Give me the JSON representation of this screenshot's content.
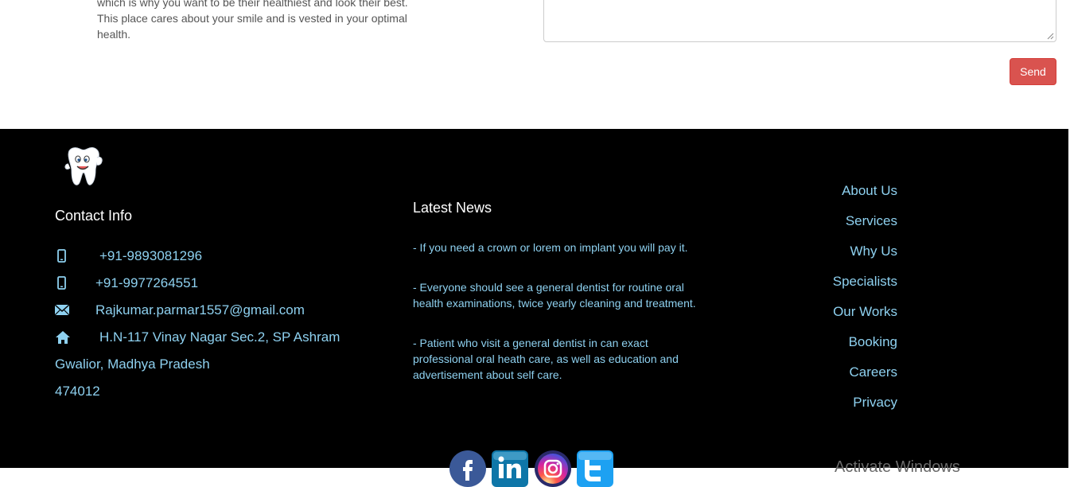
{
  "about": {
    "lines": [
      "which is why you want to be their healthiest and look their best.",
      "This place cares about your smile and is vested in your optimal",
      "health."
    ]
  },
  "contact_form": {
    "message_value": "",
    "send_label": "Send"
  },
  "footer": {
    "contact": {
      "heading": "Contact Info",
      "phone1": "+91-9893081296",
      "phone2": "+91-9977264551",
      "email": "Rajkumar.parmar1557@gmail.com",
      "address_line1": "H.N-117 Vinay Nagar Sec.2, SP Ashram",
      "address_line2": "Gwalior, Madhya Pradesh",
      "address_line3": "474012"
    },
    "news": {
      "heading": "Latest News",
      "items": [
        {
          "lines": [
            "- If you need a crown or lorem on implant you will pay it."
          ]
        },
        {
          "lines": [
            "- Everyone should see a general dentist for routine oral",
            "health examinations, twice yearly cleaning and treatment."
          ]
        },
        {
          "lines": [
            "- Patient who visit a general dentist in can exact",
            "professional oral heath care, as well as education and",
            "advertisement about self care."
          ]
        }
      ]
    },
    "links": [
      "About Us",
      "Services",
      "Why Us",
      "Specialists",
      "Our Works",
      "Booking",
      "Careers",
      "Privacy"
    ],
    "social": [
      {
        "icon": "facebook-icon",
        "color": "#3b5998"
      },
      {
        "icon": "linkedin-icon",
        "color": "#0e76a8"
      },
      {
        "icon": "instagram-icon",
        "color": "#c13584"
      },
      {
        "icon": "twitter-icon",
        "color": "#1da1f2"
      }
    ],
    "watermark": "Activate Windows"
  },
  "colors": {
    "footer_bg": "#000000",
    "link": "#8ed1f0",
    "send": "#d9534f"
  }
}
